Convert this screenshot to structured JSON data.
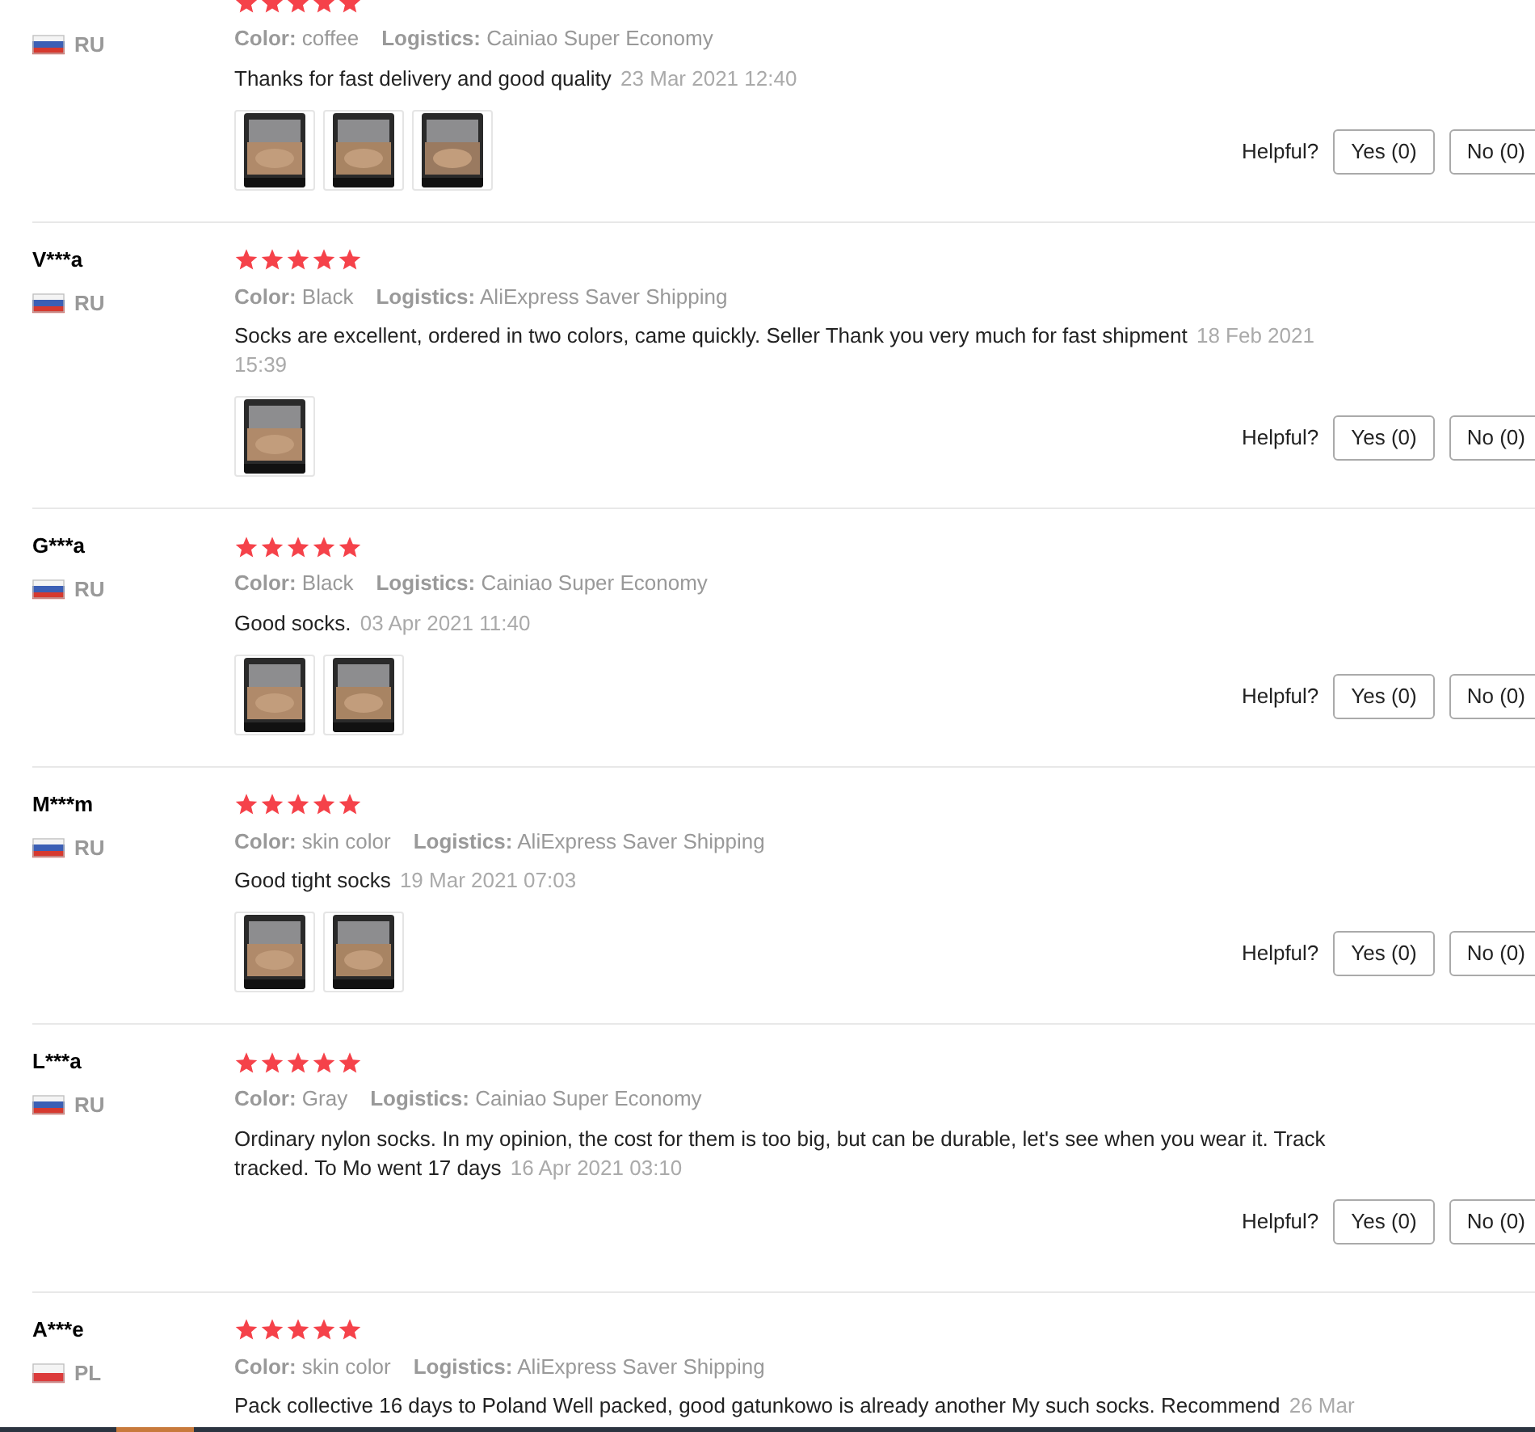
{
  "reviews": [
    {
      "stars": 5,
      "kind": "ru",
      "country": "RU",
      "color_label": "Color:",
      "variant": "coffee",
      "logistics_label": "Logistics:",
      "logistics": "Cainiao Super Economy",
      "text": "Thanks for fast delivery and good quality",
      "date": "23 Mar 2021 12:40",
      "photos": [
        {
          "kind": "picture"
        },
        {
          "kind": "picture"
        },
        {
          "kind": "picture"
        }
      ],
      "helpful_label": "Helpful?",
      "yes": "Yes (0)",
      "no": "No (0)"
    },
    {
      "name": "V***a",
      "stars": 5,
      "kind": "ru",
      "country": "RU",
      "color_label": "Color:",
      "variant": "Black",
      "logistics_label": "Logistics:",
      "logistics": "AliExpress Saver Shipping",
      "text": "Socks are excellent, ordered in two colors, came quickly. Seller Thank you very much for fast shipment",
      "date": "18 Feb 2021 15:39",
      "photos": [
        {
          "kind": "picture"
        }
      ],
      "helpful_label": "Helpful?",
      "yes": "Yes (0)",
      "no": "No (0)"
    },
    {
      "name": "G***a",
      "stars": 5,
      "kind": "ru",
      "country": "RU",
      "color_label": "Color:",
      "variant": "Black",
      "logistics_label": "Logistics:",
      "logistics": "Cainiao Super Economy",
      "text": "Good socks.",
      "date": "03 Apr 2021 11:40",
      "photos": [
        {
          "kind": "picture"
        },
        {
          "kind": "picture"
        }
      ],
      "helpful_label": "Helpful?",
      "yes": "Yes (0)",
      "no": "No (0)"
    },
    {
      "name": "M***m",
      "stars": 5,
      "kind": "ru",
      "country": "RU",
      "color_label": "Color:",
      "variant": "skin color",
      "logistics_label": "Logistics:",
      "logistics": "AliExpress Saver Shipping",
      "text": "Good tight socks",
      "date": "19 Mar 2021 07:03",
      "photos": [
        {
          "kind": "picture"
        },
        {
          "kind": "picture"
        }
      ],
      "helpful_label": "Helpful?",
      "yes": "Yes (0)",
      "no": "No (0)"
    },
    {
      "name": "L***a",
      "stars": 5,
      "kind": "ru",
      "country": "RU",
      "color_label": "Color:",
      "variant": "Gray",
      "logistics_label": "Logistics:",
      "logistics": "Cainiao Super Economy",
      "text": "Ordinary nylon socks. In my opinion, the cost for them is too big, but can be durable, let's see when you wear it. Track tracked. To Mo went 17 days",
      "date": "16 Apr 2021 03:10",
      "helpful_label": "Helpful?",
      "yes": "Yes (0)",
      "no": "No (0)"
    },
    {
      "name": "A***e",
      "stars": 5,
      "kind": "pl",
      "country": "PL",
      "color_label": "Color:",
      "variant": "skin color",
      "logistics_label": "Logistics:",
      "logistics": "AliExpress Saver Shipping",
      "text": "Pack collective 16 days to Poland Well packed, good gatunkowo is already another My such socks. Recommend",
      "date": "26 Mar"
    }
  ]
}
